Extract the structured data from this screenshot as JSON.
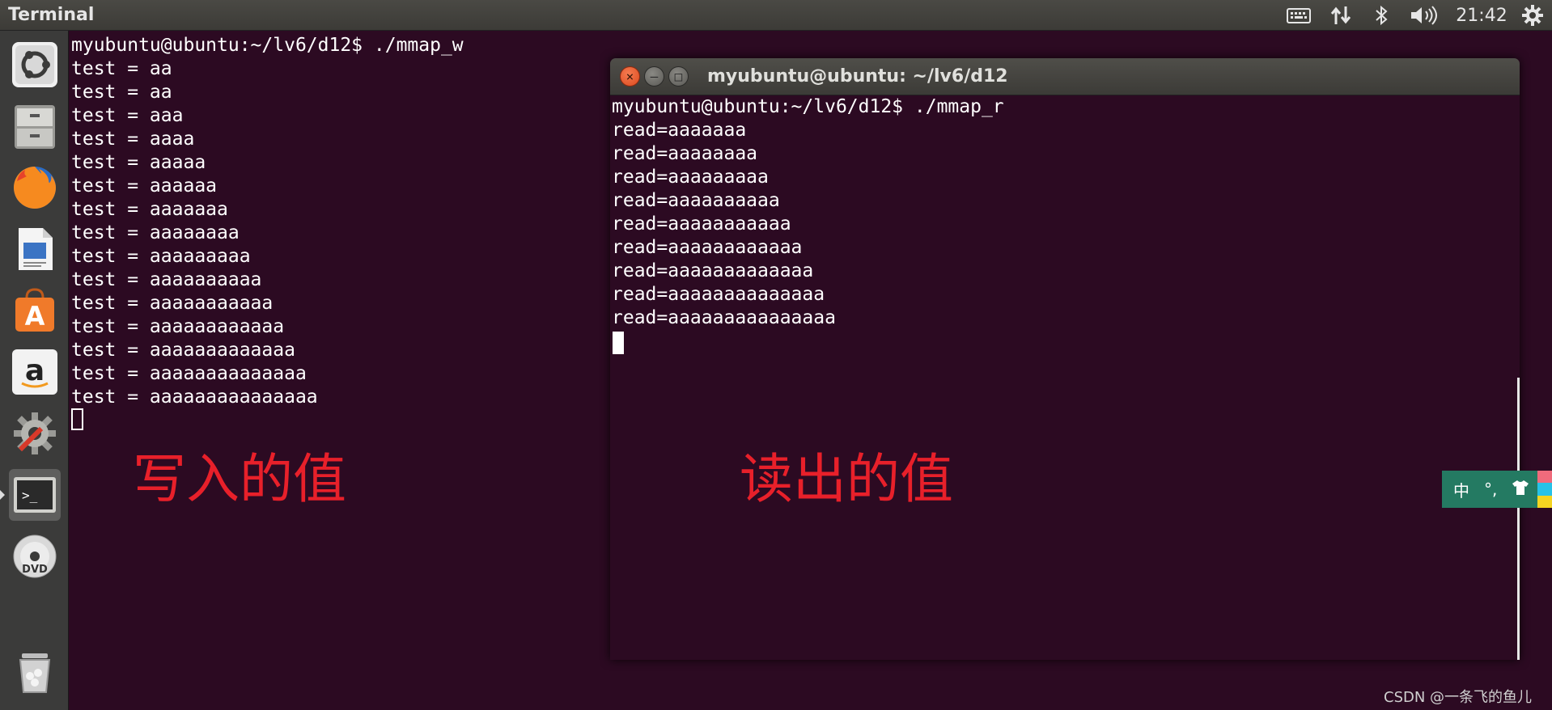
{
  "panel": {
    "app_title": "Terminal",
    "clock": "21:42",
    "tray_icons": [
      "keyboard-icon",
      "network-arrows-icon",
      "bluetooth-icon",
      "volume-icon",
      "gear-icon"
    ]
  },
  "launcher": {
    "items": [
      "ubuntu-dash-icon",
      "files-icon",
      "firefox-icon",
      "libreoffice-writer-icon",
      "software-center-icon",
      "amazon-icon",
      "system-settings-icon",
      "terminal-icon",
      "dvd-icon",
      "trash-icon"
    ],
    "active_item": "terminal-icon",
    "dvd_label": "DVD",
    "amazon_label": "a",
    "software_label": "A",
    "terminal_prompt_glyph": ">_"
  },
  "bg_terminal": {
    "lines": [
      "myubuntu@ubuntu:~/lv6/d12$ ./mmap_w",
      "test = aa",
      "test = aa",
      "test = aaa",
      "test = aaaa",
      "test = aaaaa",
      "test = aaaaaa",
      "test = aaaaaaa",
      "test = aaaaaaaa",
      "test = aaaaaaaaa",
      "test = aaaaaaaaaa",
      "test = aaaaaaaaaaa",
      "test = aaaaaaaaaaaa",
      "test = aaaaaaaaaaaaa",
      "test = aaaaaaaaaaaaaa",
      "test = aaaaaaaaaaaaaaa"
    ]
  },
  "annotations": {
    "write_label": "写入的值",
    "read_label": "读出的值",
    "color": "#e8202a"
  },
  "fg_window": {
    "title": "myubuntu@ubuntu: ~/lv6/d12",
    "close_glyph": "×",
    "minimize_glyph": "–",
    "maximize_glyph": "□",
    "lines": [
      "myubuntu@ubuntu:~/lv6/d12$ ./mmap_r",
      "read=aaaaaaa",
      "read=aaaaaaaa",
      "read=aaaaaaaaa",
      "read=aaaaaaaaaa",
      "read=aaaaaaaaaaa",
      "read=aaaaaaaaaaaa",
      "read=aaaaaaaaaaaaa",
      "read=aaaaaaaaaaaaaa",
      "read=aaaaaaaaaaaaaaa"
    ]
  },
  "ime": {
    "mode": "中",
    "punct": "°,",
    "skin_icon": "shirt-icon"
  },
  "watermark": "CSDN @一条飞的鱼儿",
  "colors": {
    "terminal_bg": "#2c0a22",
    "panel_bg": "#3c3b37",
    "ime_bg": "#247a62"
  }
}
